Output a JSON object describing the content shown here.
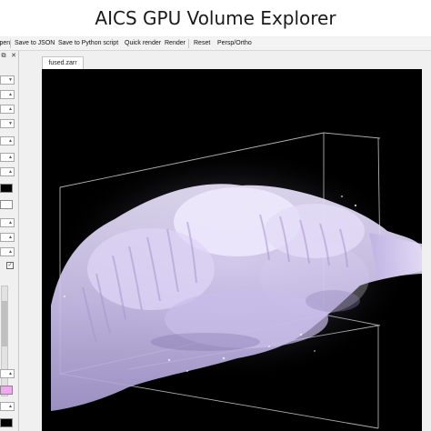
{
  "window": {
    "title": "AICS GPU Volume Explorer"
  },
  "menubar": {
    "items": [
      "Open",
      "Save to JSON",
      "Save to Python script",
      "Quick render",
      "Render",
      "Reset",
      "Persp/Ortho"
    ]
  },
  "tabs": [
    {
      "label": "fused.zarr"
    }
  ],
  "dock": {
    "float_icon": "float-icon",
    "close_icon": "close-icon"
  },
  "colors": {
    "viewport_background": "#000000",
    "volume_tint": "#d9cff2",
    "channel_swatch_1": "#000000",
    "channel_swatch_2": "#ffffff",
    "channel_swatch_3": "#f2a8f0"
  }
}
